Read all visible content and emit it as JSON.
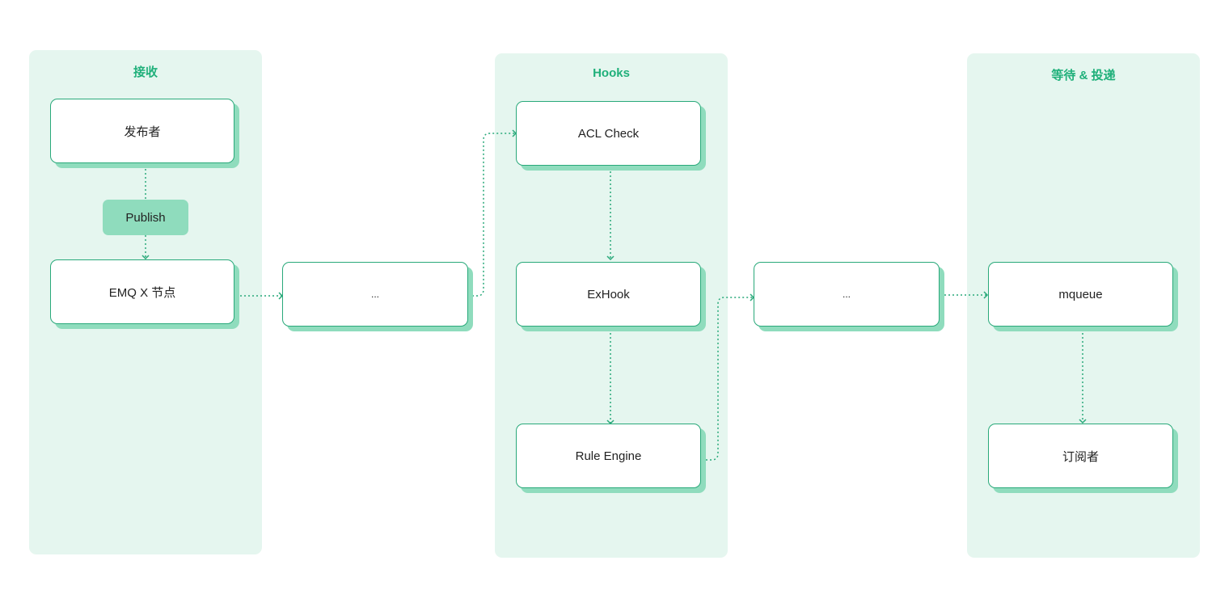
{
  "diagram": {
    "colors": {
      "accent": "#1fb07a",
      "border": "#29a97a",
      "shadow": "#8fdcbd",
      "panel_bg": "#e5f6ef"
    },
    "panels": [
      {
        "id": "receive",
        "title": "接收"
      },
      {
        "id": "hooks",
        "title": "Hooks"
      },
      {
        "id": "deliver",
        "title": "等待 & 投递"
      }
    ],
    "nodes": {
      "publisher": "发布者",
      "publish": "Publish",
      "emqx_node": "EMQ X 节点",
      "ellipsis_1": "...",
      "acl_check": "ACL Check",
      "exhook": "ExHook",
      "rule_engine": "Rule Engine",
      "ellipsis_2": "...",
      "mqueue": "mqueue",
      "subscriber": "订阅者"
    },
    "edges": [
      {
        "from": "publisher",
        "to": "publish"
      },
      {
        "from": "publish",
        "to": "emqx_node"
      },
      {
        "from": "emqx_node",
        "to": "ellipsis_1"
      },
      {
        "from": "ellipsis_1",
        "to": "acl_check"
      },
      {
        "from": "acl_check",
        "to": "exhook"
      },
      {
        "from": "exhook",
        "to": "rule_engine"
      },
      {
        "from": "rule_engine",
        "to": "ellipsis_2"
      },
      {
        "from": "ellipsis_2",
        "to": "mqueue"
      },
      {
        "from": "mqueue",
        "to": "subscriber"
      }
    ]
  }
}
